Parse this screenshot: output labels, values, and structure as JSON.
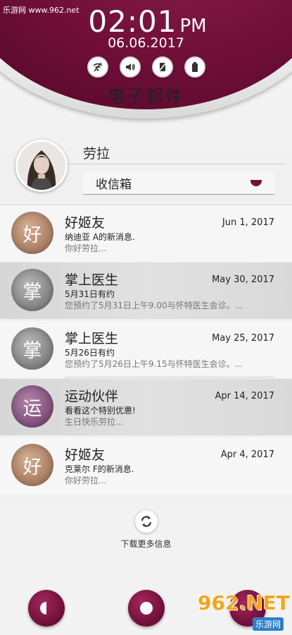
{
  "watermark_top": "乐游网 www.962.net",
  "clock": {
    "time": "02:01",
    "ampm": "PM",
    "date": "06.06.2017"
  },
  "status_icons": [
    "wifi-off-icon",
    "volume-icon",
    "vibrate-off-icon",
    "battery-icon"
  ],
  "app_title": "电子邮件",
  "profile": {
    "name": "劳拉",
    "mailbox": "收信箱"
  },
  "colors": {
    "accent": "#7a0f3e",
    "bubble_brown": "#b88c70",
    "bubble_gray": "#8f8f8f",
    "bubble_purple": "#8a5c86"
  },
  "messages": [
    {
      "initial": "好",
      "sender": "好姬友",
      "date": "Jun 1, 2017",
      "subject": "纳迪亚  A的新消息.",
      "preview": "你好劳拉...",
      "color": "brown",
      "row": "white"
    },
    {
      "initial": "掌",
      "sender": "掌上医生",
      "date": "May 30, 2017",
      "subject": "5月31日有约",
      "preview": "您预约了5月31日上午9.00与怀特医生会诊。...",
      "color": "gray",
      "row": "gray"
    },
    {
      "initial": "掌",
      "sender": "掌上医生",
      "date": "May 25, 2017",
      "subject": "5月26日有约",
      "preview": "您预约了5月26日上午9.15与怀特医生会诊。...",
      "color": "gray",
      "row": "white"
    },
    {
      "initial": "运",
      "sender": "运动伙伴",
      "date": "Apr 14, 2017",
      "subject": "看看这个特别优惠!",
      "preview": "生日快乐劳拉...",
      "color": "purple",
      "row": "gray"
    },
    {
      "initial": "好",
      "sender": "好姬友",
      "date": "Apr 4, 2017",
      "subject": "克莱尔  F的新消息.",
      "preview": "你好劳拉...",
      "color": "brown",
      "row": "white"
    }
  ],
  "load_more": "下载更多信息",
  "watermark_bottom": {
    "logo": "962.NET",
    "sub": "乐游网"
  }
}
